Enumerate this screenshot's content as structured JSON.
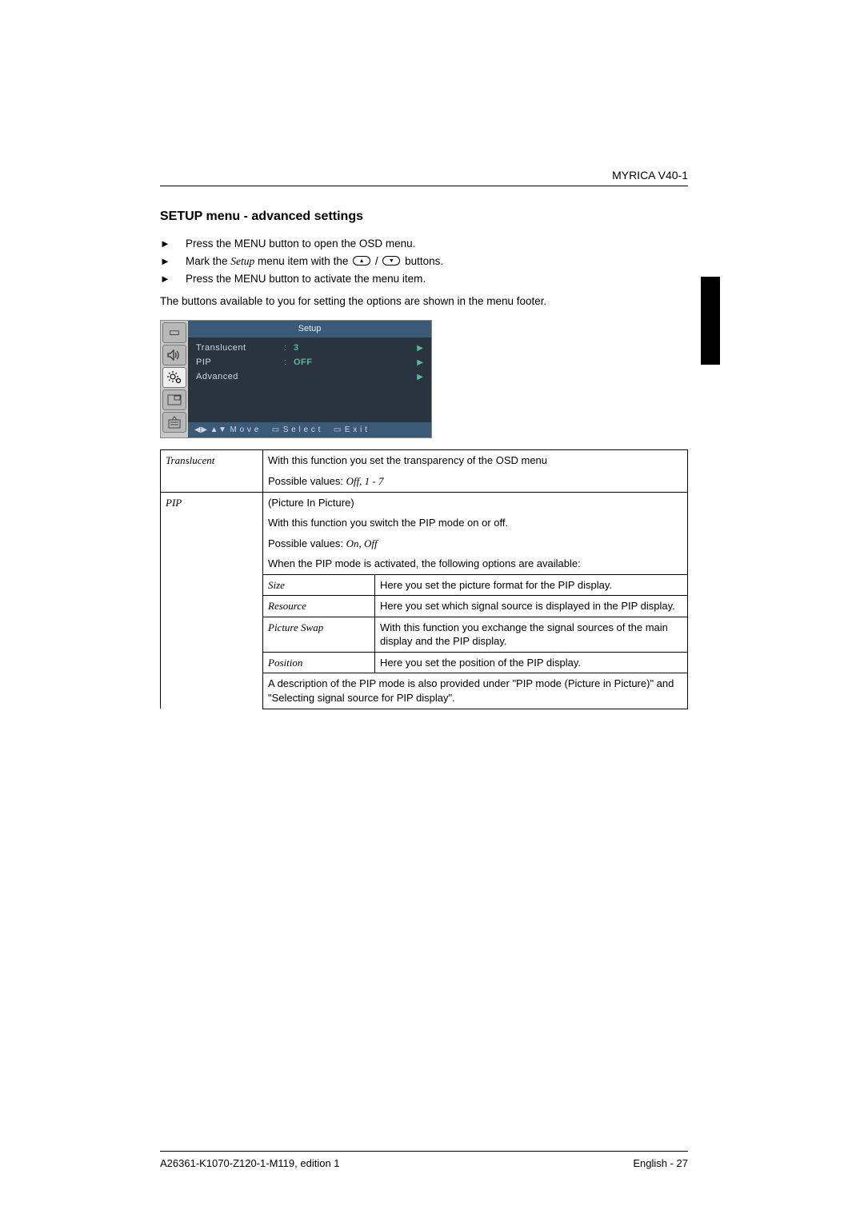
{
  "header": {
    "product": "MYRICA V40-1"
  },
  "section": {
    "title": "SETUP menu - advanced settings",
    "steps": [
      "Press the MENU button to open the OSD menu.",
      "Mark the |Setup| menu item with the |UP| / |DOWN| buttons.",
      "Press the MENU button to activate the menu item."
    ],
    "note": "The buttons available to you for setting the options are shown in the menu footer."
  },
  "osd": {
    "title": "Setup",
    "rows": [
      {
        "label": "Translucent",
        "value": "3",
        "arrow": true
      },
      {
        "label": "PIP",
        "value": "OFF",
        "arrow": true
      },
      {
        "label": "Advanced",
        "value": "",
        "arrow": true
      }
    ],
    "footer": {
      "move": "M o v e",
      "select": "S e l e c t",
      "exit": "E x i t"
    }
  },
  "table": {
    "translucent": {
      "name": "Translucent",
      "desc": "With this function you set the transparency of the OSD menu",
      "values_prefix": "Possible values: ",
      "values": "Off, 1 - 7"
    },
    "pip": {
      "name": "PIP",
      "line1": "(Picture In Picture)",
      "line2": "With this function you switch the PIP mode on or off.",
      "values_prefix": "Possible values: ",
      "values": "On, Off",
      "line3": "When the PIP mode is activated, the following options are available:",
      "subs": [
        {
          "name": "Size",
          "desc": "Here you set the picture format for the PIP display."
        },
        {
          "name": "Resource",
          "desc": "Here you set which signal source is displayed in the PIP display."
        },
        {
          "name": "Picture Swap",
          "desc": "With this function you exchange the signal sources of the main display and the PIP display."
        },
        {
          "name": "Position",
          "desc": "Here you set the position of the PIP display."
        }
      ],
      "footnote": "A description of the PIP mode is also provided under \"PIP mode (Picture in Picture)\" and \"Selecting signal source for PIP display\"."
    }
  },
  "footer": {
    "left": "A26361-K1070-Z120-1-M119, edition 1",
    "right": "English - 27"
  }
}
